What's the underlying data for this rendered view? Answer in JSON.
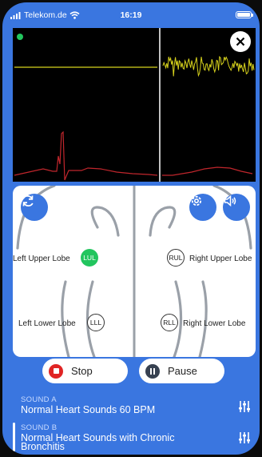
{
  "statusbar": {
    "carrier": "Telekom.de",
    "time": "16:19"
  },
  "colors": {
    "accent": "#3a76e0",
    "trace_top": "#d7d21c",
    "trace_bottom": "#c0262c",
    "active_lobe": "#22c55e"
  },
  "monitor": {
    "close_icon": "close-icon"
  },
  "lobes": {
    "lul": {
      "label": "Left Upper Lobe",
      "badge": "LUL",
      "active": true
    },
    "rul": {
      "label": "Right Upper Lobe",
      "badge": "RUL",
      "active": false
    },
    "lll": {
      "label": "Left Lower Lobe",
      "badge": "LLL",
      "active": false
    },
    "rll": {
      "label": "Right Lower Lobe",
      "badge": "RLL",
      "active": false
    }
  },
  "controls": {
    "stop_label": "Stop",
    "pause_label": "Pause"
  },
  "sounds": [
    {
      "tag": "SOUND A",
      "name": "Normal Heart Sounds 60 BPM"
    },
    {
      "tag": "SOUND B",
      "name": "Normal Heart Sounds with Chronic Bronchitis"
    }
  ]
}
